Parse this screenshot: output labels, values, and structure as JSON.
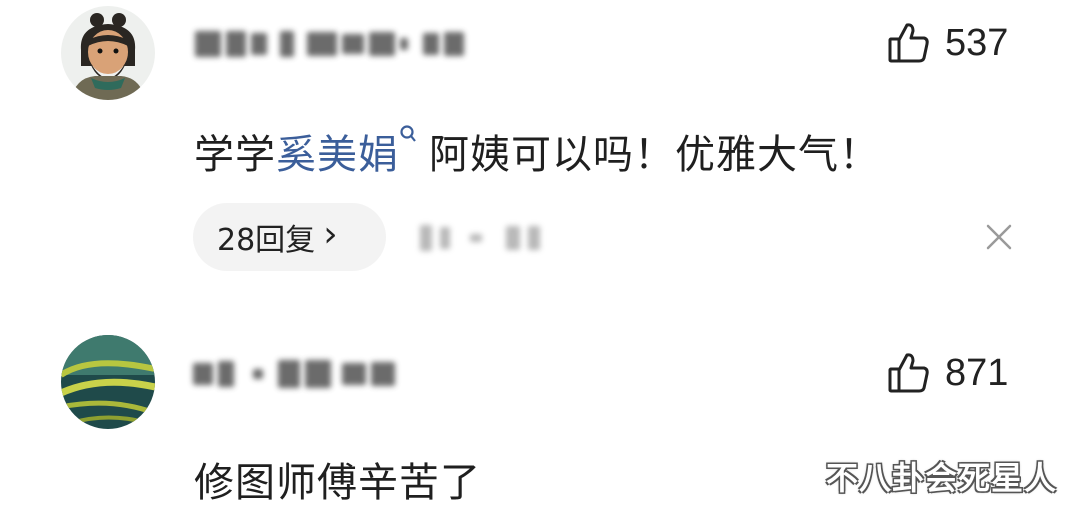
{
  "comments": [
    {
      "avatar": "cartoon-bearded-man-avatar",
      "username_obscured": true,
      "likes": "537",
      "text_before": "学学",
      "text_link": "奚美娟",
      "text_after": "阿姨可以吗！优雅大气！",
      "reply_label": "28回复",
      "reply_chevron": "›",
      "meta_obscured": true
    },
    {
      "avatar": "green-leaf-avatar",
      "username_obscured": true,
      "likes": "871",
      "text": "修图师傅辛苦了"
    }
  ],
  "icons": {
    "like": "thumbs-up-icon",
    "close": "close-icon",
    "search": "search-icon"
  },
  "watermark": "不八卦会死星人",
  "colors": {
    "link": "#3b5e9a",
    "pill_bg": "#f3f3f3",
    "text": "#222222"
  }
}
